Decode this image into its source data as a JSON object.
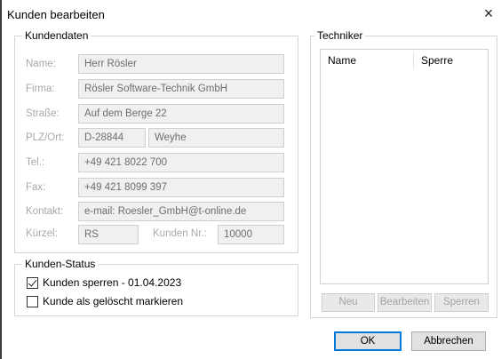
{
  "window": {
    "title": "Kunden bearbeiten",
    "close_symbol": "×"
  },
  "kundendaten": {
    "legend": "Kundendaten",
    "fields": {
      "name": {
        "label": "Name:",
        "value": "Herr Rösler"
      },
      "firma": {
        "label": "Firma:",
        "value": "Rösler Software-Technik GmbH"
      },
      "strasse": {
        "label": "Straße:",
        "value": "Auf dem Berge 22"
      },
      "plz_ort": {
        "label": "PLZ/Ort:",
        "plz": "D-28844",
        "ort": "Weyhe"
      },
      "tel": {
        "label": "Tel.:",
        "value": "+49 421 8022 700"
      },
      "fax": {
        "label": "Fax:",
        "value": "+49 421 8099 397"
      },
      "kontakt": {
        "label": "Kontakt:",
        "value": "e-mail: Roesler_GmbH@t-online.de"
      },
      "kuerzel": {
        "label": "Kürzel:",
        "value": "RS"
      },
      "kunden_nr": {
        "label": "Kunden Nr.:",
        "value": "10000"
      }
    }
  },
  "kunden_status": {
    "legend": "Kunden-Status",
    "sperren": {
      "label": "Kunden sperren - 01.04.2023",
      "checked": true
    },
    "geloescht": {
      "label": "Kunde als gelöscht markieren",
      "checked": false
    }
  },
  "techniker": {
    "legend": "Techniker",
    "columns": [
      "Name",
      "Sperre"
    ],
    "rows": [],
    "buttons": {
      "neu": "Neu",
      "bearbeiten": "Bearbeiten",
      "sperren": "Sperren"
    }
  },
  "footer": {
    "ok": "OK",
    "abbrechen": "Abbrechen"
  },
  "colors": {
    "focus_border": "#0078d7",
    "disabled_text": "#a3a3a3",
    "field_bg": "#f0f0f0"
  }
}
